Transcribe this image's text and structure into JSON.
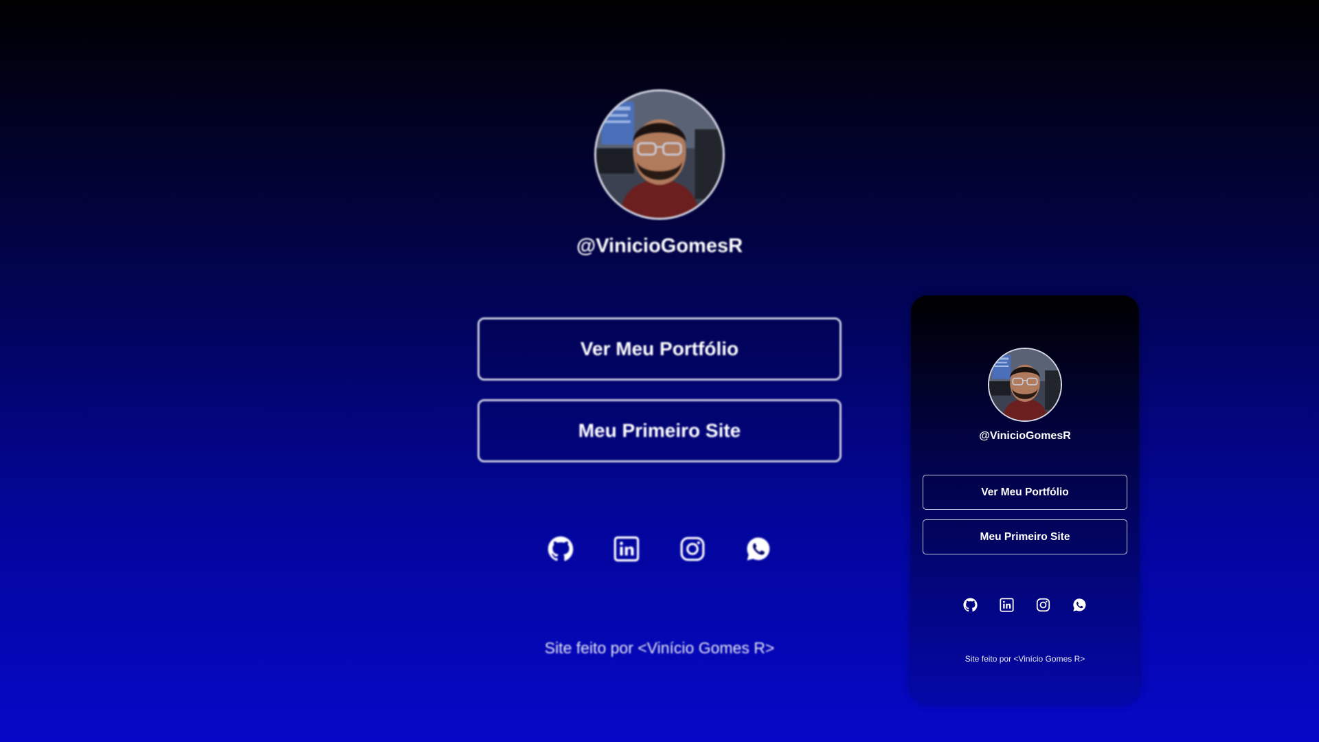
{
  "profile": {
    "handle": "@VinicioGomesR",
    "avatar_alt": "profile-photo"
  },
  "buttons": {
    "portfolio": "Ver Meu Portfólio",
    "first_site": "Meu Primeiro Site"
  },
  "socials": [
    {
      "icon": "github-icon"
    },
    {
      "icon": "linkedin-icon"
    },
    {
      "icon": "instagram-icon"
    },
    {
      "icon": "whatsapp-icon"
    }
  ],
  "footer": {
    "credit": "Site feito por <Vinício Gomes R>"
  },
  "colors": {
    "background_top": "#000000",
    "background_bottom": "#0608c8",
    "button_border": "#c9cce0",
    "text": "#ffffff"
  }
}
